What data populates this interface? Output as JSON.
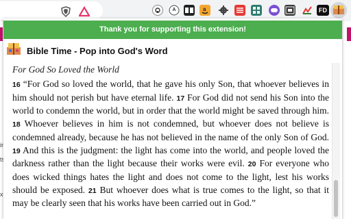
{
  "banner": {
    "text": "Thank you for supporting this extension!"
  },
  "app": {
    "title": "Bible Time - Pop into God's Word"
  },
  "reading": {
    "heading": "For God So Loved the World",
    "verses": [
      {
        "num": "16",
        "text": "“For God so loved the world, that he gave his only Son, that whoever believes in him should not perish but have eternal life."
      },
      {
        "num": "17",
        "text": "For God did not send his Son into the world to condemn the world, but in order that the world might be saved through him."
      },
      {
        "num": "18",
        "text": "Whoever believes in him is not condemned, but whoever does not believe is condemned already, because he has not believed in the name of the only Son of God."
      },
      {
        "num": "19",
        "text": "And this is the judgment: the light has come into the world, and people loved the darkness rather than the light because their works were evil."
      },
      {
        "num": "20",
        "text": "For everyone who does wicked things hates the light and does not come to the light, lest his works should be exposed."
      },
      {
        "num": "21",
        "text": "But whoever does what is true comes to the light, so that it may be clearly seen that his works have been carried out in God.”"
      }
    ]
  },
  "extensions": {
    "mail_badge": "A",
    "fd_label": "FD"
  },
  "background_page": {
    "frag1": "ir",
    "frag2": "ts",
    "frag3": "xc"
  },
  "colors": {
    "banner": "#4cae4f",
    "accent": "#c1126a"
  }
}
